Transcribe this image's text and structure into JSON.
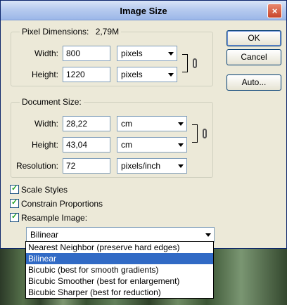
{
  "window": {
    "title": "Image Size",
    "close": "×"
  },
  "pixel_dimensions": {
    "label": "Pixel Dimensions:",
    "size": "2,79M",
    "width_label": "Width:",
    "width_value": "800",
    "width_unit": "pixels",
    "height_label": "Height:",
    "height_value": "1220",
    "height_unit": "pixels"
  },
  "document_size": {
    "label": "Document Size:",
    "width_label": "Width:",
    "width_value": "28,22",
    "width_unit": "cm",
    "height_label": "Height:",
    "height_value": "43,04",
    "height_unit": "cm",
    "resolution_label": "Resolution:",
    "resolution_value": "72",
    "resolution_unit": "pixels/inch"
  },
  "buttons": {
    "ok": "OK",
    "cancel": "Cancel",
    "auto": "Auto..."
  },
  "options": {
    "scale_styles": "Scale Styles",
    "constrain_proportions": "Constrain Proportions",
    "resample_image": "Resample Image:"
  },
  "resample": {
    "selected": "Bilinear",
    "items": [
      "Nearest Neighbor (preserve hard edges)",
      "Bilinear",
      "Bicubic (best for smooth gradients)",
      "Bicubic Smoother (best for enlargement)",
      "Bicubic Sharper (best for reduction)"
    ]
  }
}
